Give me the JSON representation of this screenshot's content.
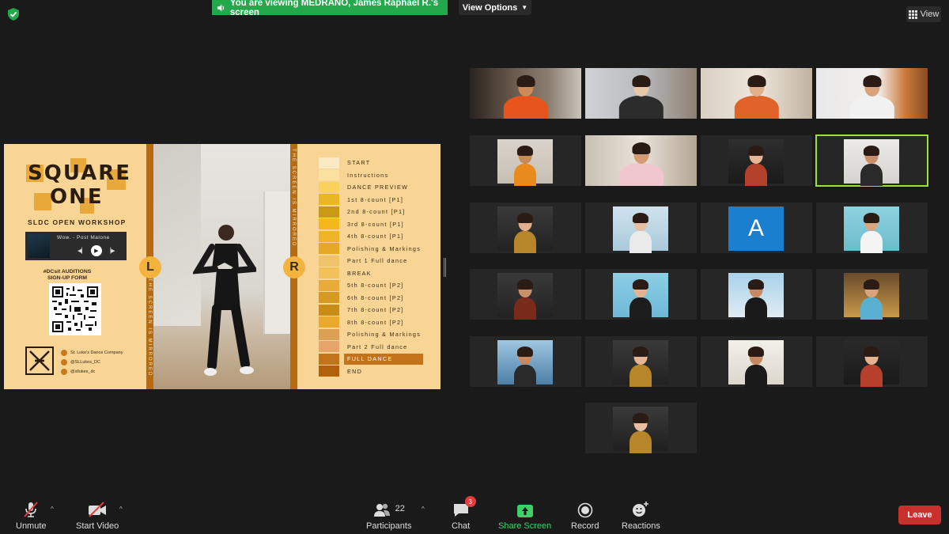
{
  "top": {
    "banner_text": "You are viewing MEDRANO, James Raphael R.'s screen",
    "view_options_label": "View Options",
    "view_label": "View"
  },
  "share": {
    "title_line1": "SQUARE",
    "title_line2": "ONE",
    "workshop": "SLDC OPEN WORKSHOP",
    "song": "Wow. - Post Malone",
    "auditions_line1": "#DCsit AUDITIONS",
    "auditions_line2": "SIGN-UP FORM",
    "socials": [
      "St. Luke's Dance Company",
      "@SLLukes_DC",
      "@sllukes_dc"
    ],
    "mirror_text": "THE SCREEN IS MIRRORED",
    "left_marker": "L",
    "right_marker": "R",
    "schedule": [
      {
        "label": "START",
        "color": "#fbe9c4"
      },
      {
        "label": "Instructions",
        "color": "#fbe19f"
      },
      {
        "label": "DANCE PREVIEW",
        "color": "#f8d25d"
      },
      {
        "label": "1st 8-count [P1]",
        "color": "#e9b726"
      },
      {
        "label": "2nd 8-count [P1]",
        "color": "#c99a14"
      },
      {
        "label": "3rd 8-count [P1]",
        "color": "#f4b81d"
      },
      {
        "label": "4th 8-count [P1]",
        "color": "#f0b42a"
      },
      {
        "label": "Polishing & Markings",
        "color": "#e6a927"
      },
      {
        "label": "Part 1 Full dance",
        "color": "#eec36a"
      },
      {
        "label": "BREAK",
        "color": "#f2c15a"
      },
      {
        "label": "5th 8-count [P2]",
        "color": "#e8ab3a"
      },
      {
        "label": "6th 8-count [P2]",
        "color": "#d59a1f"
      },
      {
        "label": "7th 8-count [P2]",
        "color": "#c88d19"
      },
      {
        "label": "8th 8-count [P2]",
        "color": "#e8a92e"
      },
      {
        "label": "Polishing & Markings",
        "color": "#dba055"
      },
      {
        "label": "Part 2 Full dance",
        "color": "#e5a46a"
      },
      {
        "label": "FULL DANCE",
        "color": "#c4731a"
      },
      {
        "label": "END",
        "color": "#b3600c"
      }
    ]
  },
  "gallery": {
    "avatar_letter": "A"
  },
  "toolbar": {
    "unmute": "Unmute",
    "start_video": "Start Video",
    "participants": "Participants",
    "participants_count": "22",
    "chat": "Chat",
    "chat_badge": "3",
    "share_screen": "Share Screen",
    "record": "Record",
    "reactions": "Reactions",
    "leave": "Leave"
  }
}
